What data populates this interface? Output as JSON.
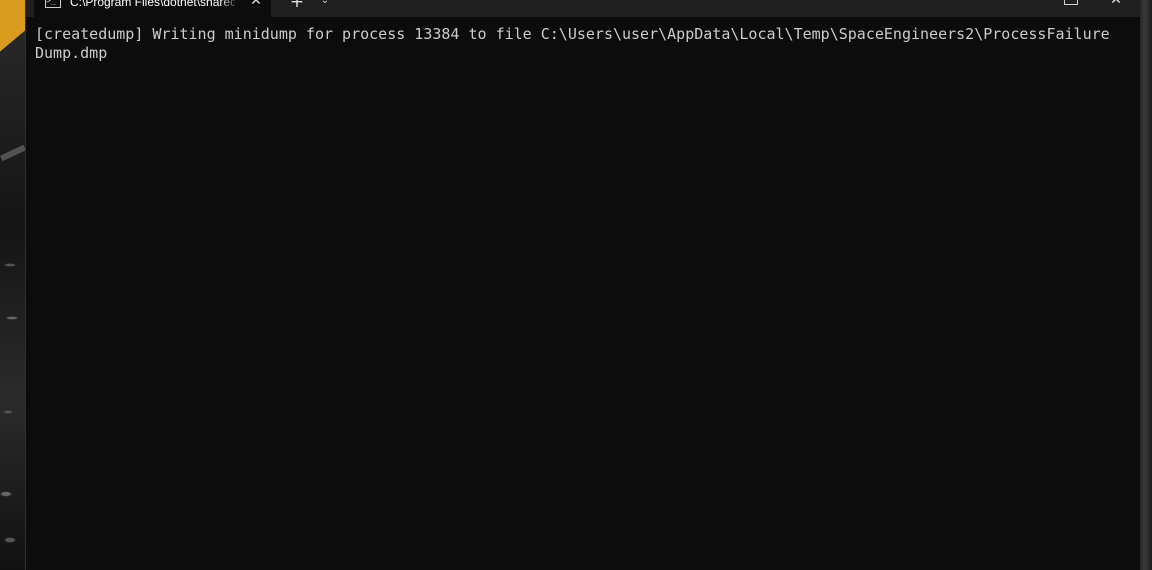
{
  "window": {
    "tab_title": "C:\\Program Files\\dotnet\\shared",
    "tab_icon": "terminal-icon",
    "close_tab_glyph": "✕",
    "new_tab_glyph": "+",
    "dropdown_glyph": "⌄",
    "close_window_glyph": "✕"
  },
  "terminal": {
    "output": "[createdump] Writing minidump for process 13384 to file C:\\Users\\user\\AppData\\Local\\Temp\\SpaceEngineers2\\ProcessFailureDump.dmp"
  },
  "colors": {
    "terminal_bg": "#0c0c0c",
    "terminal_fg": "#cccccc",
    "titlebar_bg": "#202020",
    "accent_stripe": "#d99a1e"
  }
}
